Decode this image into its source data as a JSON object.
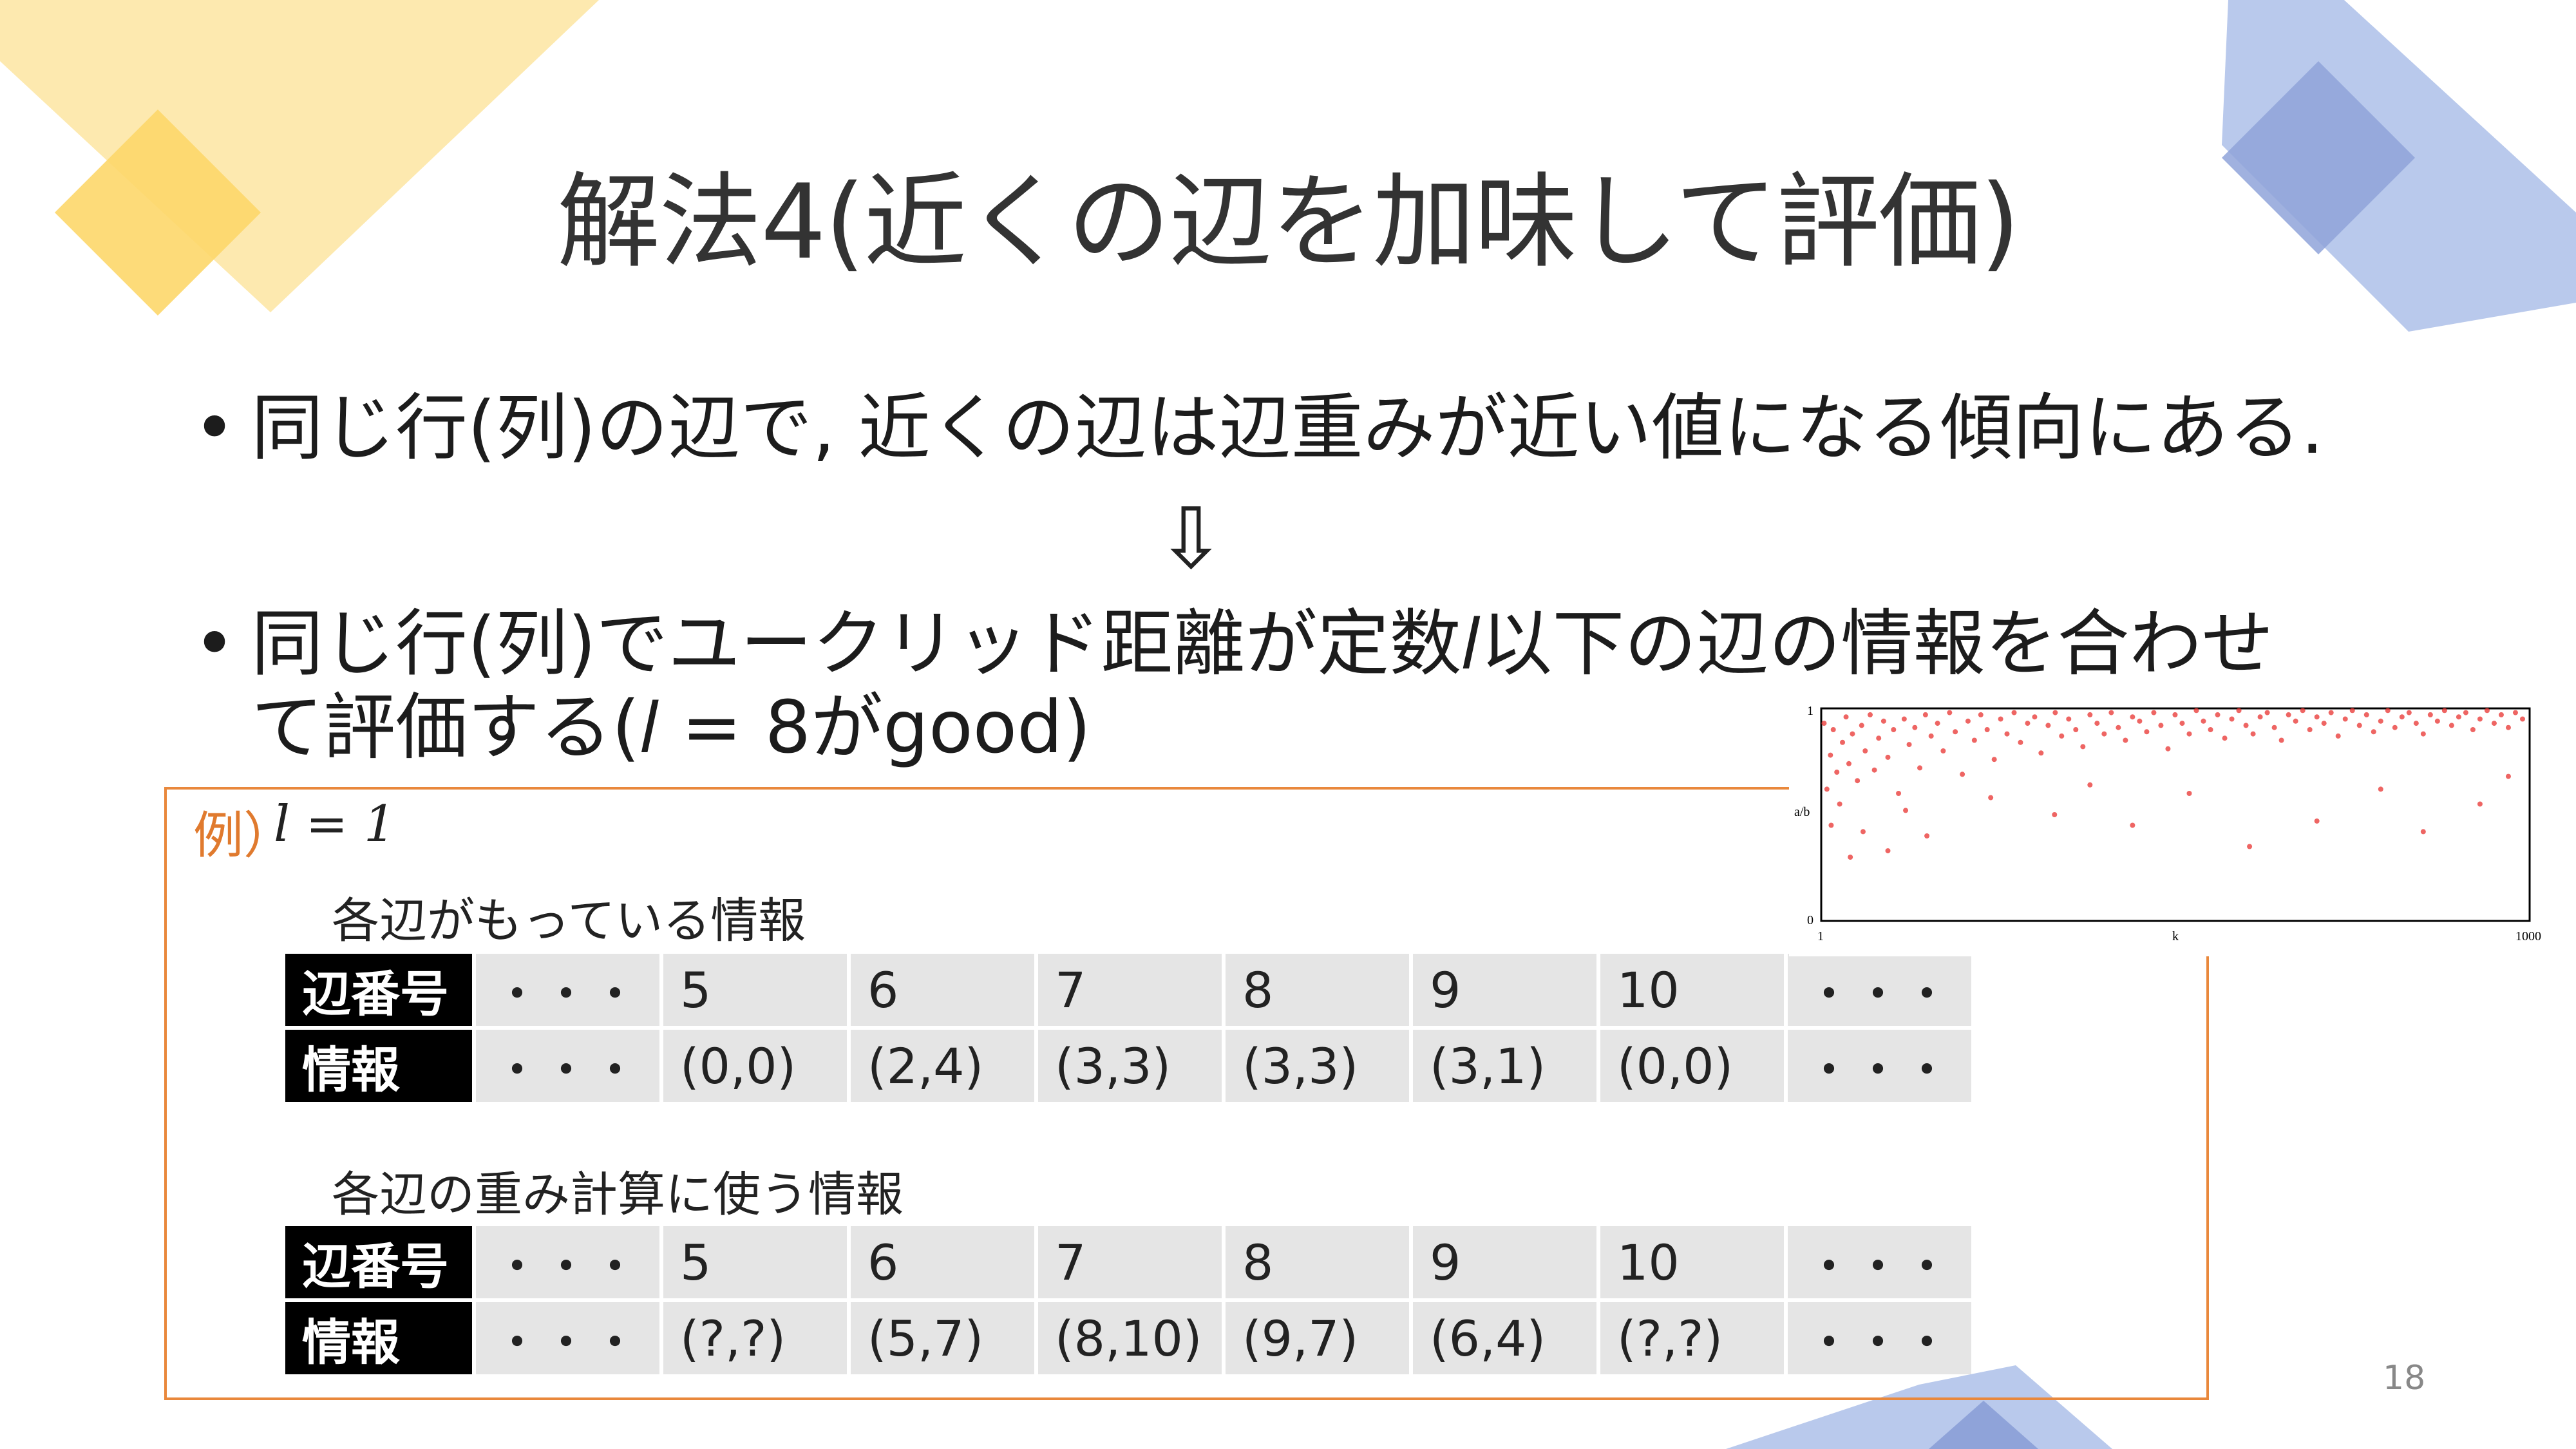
{
  "slide": {
    "title": "解法4(近くの辺を加味して評価)",
    "bullets": [
      "同じ行(列)の辺で, 近くの辺は辺重みが近い値になる傾向にある.",
      "同じ行(列)でユークリッド距離が定数𝑙以下の辺の情報を合わせ",
      "て評価する(𝑙 = 8がgood)"
    ],
    "arrow": "⇩",
    "bullet_symbol": "•",
    "page_number": "18"
  },
  "example": {
    "label": "例）",
    "equation": "𝑙 = 1",
    "table1": {
      "caption": "各辺がもっている情報",
      "row1": [
        "辺番号",
        "・・・",
        "5",
        "6",
        "7",
        "8",
        "9",
        "10",
        "・・・"
      ],
      "row2": [
        "情報",
        "・・・",
        "(0,0)",
        "(2,4)",
        "(3,3)",
        "(3,3)",
        "(3,1)",
        "(0,0)",
        "・・・"
      ]
    },
    "table2": {
      "caption": "各辺の重み計算に使う情報",
      "row1": [
        "辺番号",
        "・・・",
        "5",
        "6",
        "7",
        "8",
        "9",
        "10",
        "・・・"
      ],
      "row2": [
        "情報",
        "・・・",
        "(?,?)",
        "(5,7)",
        "(8,10)",
        "(9,7)",
        "(6,4)",
        "(?,?)",
        "・・・"
      ]
    }
  },
  "chart_data": {
    "type": "scatter",
    "xlabel": "k",
    "ylabel": "a/b",
    "xlim": [
      1,
      1000
    ],
    "ylim": [
      0,
      1
    ],
    "x_ticks": [
      "1",
      "k",
      "1000"
    ],
    "y_ticks": [
      "1",
      "a/b",
      "0"
    ],
    "series": [
      {
        "color": "#e8322f",
        "points": [
          [
            5,
            0.93
          ],
          [
            9,
            0.62
          ],
          [
            14,
            0.78
          ],
          [
            18,
            0.9
          ],
          [
            23,
            0.7
          ],
          [
            27,
            0.55
          ],
          [
            31,
            0.84
          ],
          [
            36,
            0.96
          ],
          [
            40,
            0.74
          ],
          [
            45,
            0.88
          ],
          [
            52,
            0.66
          ],
          [
            58,
            0.92
          ],
          [
            63,
            0.8
          ],
          [
            70,
            0.97
          ],
          [
            76,
            0.71
          ],
          [
            82,
            0.86
          ],
          [
            89,
            0.94
          ],
          [
            95,
            0.77
          ],
          [
            103,
            0.9
          ],
          [
            110,
            0.6
          ],
          [
            118,
            0.95
          ],
          [
            125,
            0.83
          ],
          [
            133,
            0.91
          ],
          [
            140,
            0.72
          ],
          [
            148,
            0.97
          ],
          [
            156,
            0.87
          ],
          [
            165,
            0.93
          ],
          [
            173,
            0.8
          ],
          [
            182,
            0.98
          ],
          [
            190,
            0.89
          ],
          [
            200,
            0.69
          ],
          [
            208,
            0.94
          ],
          [
            217,
            0.85
          ],
          [
            226,
            0.97
          ],
          [
            235,
            0.9
          ],
          [
            245,
            0.76
          ],
          [
            254,
            0.95
          ],
          [
            263,
            0.88
          ],
          [
            273,
            0.98
          ],
          [
            282,
            0.84
          ],
          [
            292,
            0.93
          ],
          [
            302,
            0.96
          ],
          [
            311,
            0.79
          ],
          [
            321,
            0.92
          ],
          [
            331,
            0.98
          ],
          [
            340,
            0.87
          ],
          [
            350,
            0.95
          ],
          [
            360,
            0.9
          ],
          [
            370,
            0.82
          ],
          [
            380,
            0.97
          ],
          [
            390,
            0.93
          ],
          [
            400,
            0.88
          ],
          [
            410,
            0.98
          ],
          [
            420,
            0.91
          ],
          [
            430,
            0.85
          ],
          [
            440,
            0.96
          ],
          [
            450,
            0.94
          ],
          [
            460,
            0.89
          ],
          [
            470,
            0.98
          ],
          [
            480,
            0.92
          ],
          [
            490,
            0.81
          ],
          [
            500,
            0.97
          ],
          [
            510,
            0.93
          ],
          [
            520,
            0.88
          ],
          [
            530,
            0.99
          ],
          [
            540,
            0.94
          ],
          [
            550,
            0.9
          ],
          [
            560,
            0.97
          ],
          [
            570,
            0.86
          ],
          [
            580,
            0.95
          ],
          [
            590,
            0.99
          ],
          [
            600,
            0.92
          ],
          [
            610,
            0.88
          ],
          [
            620,
            0.96
          ],
          [
            630,
            0.98
          ],
          [
            640,
            0.91
          ],
          [
            650,
            0.85
          ],
          [
            660,
            0.97
          ],
          [
            670,
            0.94
          ],
          [
            680,
            0.99
          ],
          [
            690,
            0.9
          ],
          [
            700,
            0.96
          ],
          [
            710,
            0.93
          ],
          [
            720,
            0.98
          ],
          [
            730,
            0.87
          ],
          [
            740,
            0.95
          ],
          [
            750,
            0.99
          ],
          [
            760,
            0.92
          ],
          [
            770,
            0.97
          ],
          [
            780,
            0.89
          ],
          [
            790,
            0.94
          ],
          [
            800,
            0.99
          ],
          [
            810,
            0.91
          ],
          [
            820,
            0.96
          ],
          [
            830,
            0.98
          ],
          [
            840,
            0.93
          ],
          [
            850,
            0.88
          ],
          [
            860,
            0.97
          ],
          [
            870,
            0.94
          ],
          [
            880,
            0.99
          ],
          [
            890,
            0.92
          ],
          [
            900,
            0.96
          ],
          [
            910,
            0.98
          ],
          [
            920,
            0.9
          ],
          [
            930,
            0.95
          ],
          [
            940,
            0.99
          ],
          [
            950,
            0.93
          ],
          [
            960,
            0.97
          ],
          [
            970,
            0.91
          ],
          [
            980,
            0.98
          ],
          [
            990,
            0.95
          ],
          [
            15,
            0.45
          ],
          [
            42,
            0.3
          ],
          [
            60,
            0.42
          ],
          [
            95,
            0.33
          ],
          [
            150,
            0.4
          ],
          [
            330,
            0.5
          ],
          [
            440,
            0.45
          ],
          [
            605,
            0.35
          ],
          [
            700,
            0.47
          ],
          [
            850,
            0.42
          ],
          [
            930,
            0.55
          ],
          [
            240,
            0.58
          ],
          [
            520,
            0.6
          ],
          [
            790,
            0.62
          ],
          [
            120,
            0.52
          ],
          [
            380,
            0.64
          ],
          [
            970,
            0.68
          ]
        ]
      }
    ]
  }
}
